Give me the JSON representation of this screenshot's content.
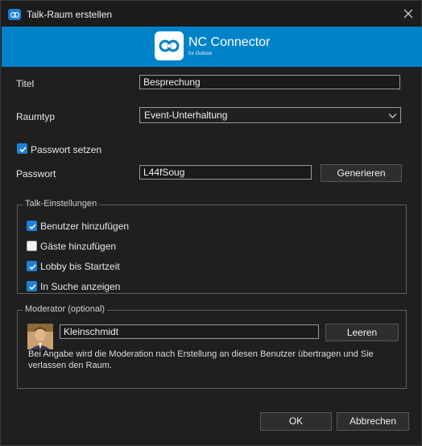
{
  "window": {
    "title": "Talk-Raum erstellen"
  },
  "banner": {
    "title": "NC Connector",
    "subtitle": "for Outlook"
  },
  "form": {
    "titel_label": "Titel",
    "titel_value": "Besprechung",
    "raumtyp_label": "Raumtyp",
    "raumtyp_value": "Event-Unterhaltung",
    "passwort_setzen_label": "Passwort setzen",
    "passwort_setzen_checked": true,
    "passwort_label": "Passwort",
    "passwort_value": "L44fSoug",
    "generieren_label": "Generieren"
  },
  "talk_settings": {
    "title": "Talk-Einstellungen",
    "items": [
      {
        "label": "Benutzer hinzufügen",
        "checked": true
      },
      {
        "label": "Gäste hinzufügen",
        "checked": false
      },
      {
        "label": "Lobby bis Startzeit",
        "checked": true
      },
      {
        "label": "In Suche anzeigen",
        "checked": true
      }
    ]
  },
  "moderator": {
    "title": "Moderator (optional)",
    "value": "Kleinschmidt",
    "clear_label": "Leeren",
    "description": "Bei Angabe wird die Moderation nach Erstellung an diesen Benutzer übertragen und Sie verlassen den Raum."
  },
  "footer": {
    "ok_label": "OK",
    "cancel_label": "Abbrechen"
  },
  "colors": {
    "accent": "#0082c9",
    "checkbox": "#1d7fd6",
    "background": "#1f1f1f"
  }
}
